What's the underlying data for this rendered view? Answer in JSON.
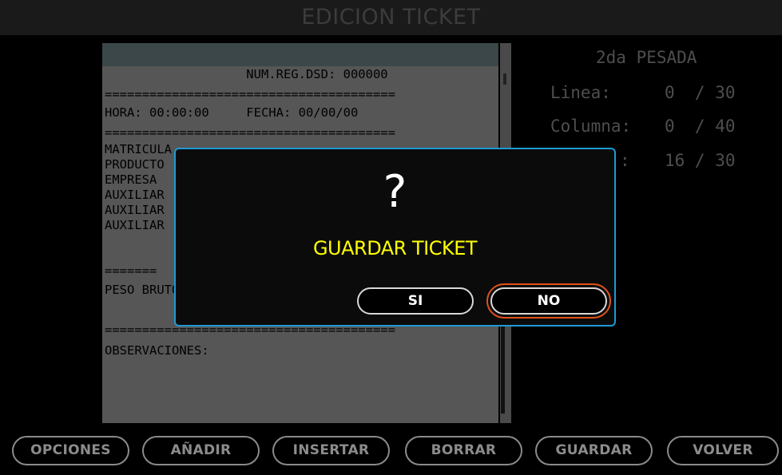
{
  "header": {
    "title": "EDICION TICKET"
  },
  "ticket": {
    "lines": [
      "                   NUM.REG.DSD: 000000",
      "=======================================",
      "HORA: 00:00:00     FECHA: 00/00/00",
      "=======================================",
      "MATRICULA",
      "PRODUCTO",
      "EMPRESA",
      "AUXILIAR",
      "AUXILIAR",
      "AUXILIAR",
      "=======",
      "PESO BRUTO",
      "",
      "=======================================",
      "OBSERVACIONES:"
    ]
  },
  "info": {
    "heading": "2da PESADA",
    "linea_label": "Linea:",
    "linea_value": "0  / 30",
    "columna_label": "Columna:",
    "columna_value": "0  / 40",
    "third_label": ":",
    "third_value": "16 / 30"
  },
  "dialog": {
    "question": "?",
    "message": "GUARDAR TICKET",
    "yes_label": "SI",
    "no_label": "NO",
    "accent_color": "#1e9ad6",
    "focus_color": "#e0521a",
    "message_color": "#ffff00"
  },
  "toolbar": {
    "opciones": "OPCIONES",
    "anadir": "AÑADIR",
    "insertar": "INSERTAR",
    "borrar": "BORRAR",
    "guardar": "GUARDAR",
    "volver": "VOLVER"
  }
}
